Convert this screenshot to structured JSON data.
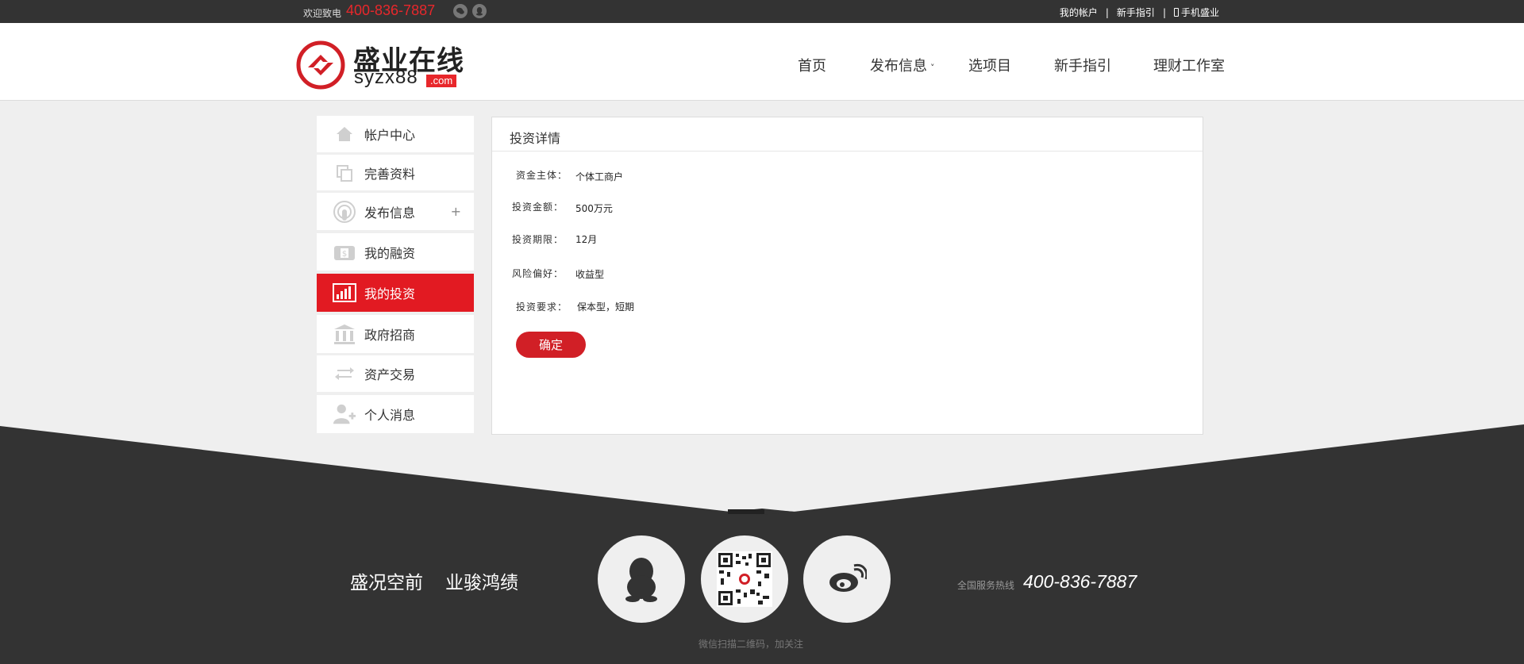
{
  "topbar": {
    "welcome": "欢迎致电",
    "phone": "400-836-7887",
    "social_icons": [
      "wechat-icon",
      "qq-icon"
    ],
    "links": [
      "我的帐户",
      "新手指引",
      "手机盛业"
    ],
    "separator": "|"
  },
  "header": {
    "logo_cn": "盛业在线",
    "logo_en": "syzx88",
    "logo_domain": ".com",
    "nav": [
      {
        "label": "首页"
      },
      {
        "label": "发布信息",
        "caret": "˅"
      },
      {
        "label": "选项目"
      },
      {
        "label": "新手指引"
      },
      {
        "label": "理财工作室"
      }
    ]
  },
  "sidebar": {
    "items": [
      {
        "label": "帐户中心",
        "icon": "home-icon"
      },
      {
        "label": "完善资料",
        "icon": "copy-icon"
      },
      {
        "label": "发布信息",
        "icon": "broadcast-icon",
        "expander": "+"
      },
      {
        "label": "我的融资",
        "icon": "wallet-icon"
      },
      {
        "label": "我的投资",
        "icon": "bar-chart-icon",
        "active": true
      },
      {
        "label": "政府招商",
        "icon": "government-building-icon"
      },
      {
        "label": "资产交易",
        "icon": "exchange-arrows-icon"
      },
      {
        "label": "个人消息",
        "icon": "user-add-icon"
      }
    ],
    "active_color": "#e21a22"
  },
  "panel": {
    "title": "投资详情",
    "fields": [
      {
        "label": "资金主体：",
        "value": "个体工商户"
      },
      {
        "label": "投资金额：",
        "value": "500万元"
      },
      {
        "label": "投资期限：",
        "value": "12月"
      },
      {
        "label": "风险偏好：",
        "value": "收益型"
      },
      {
        "label": "投资要求：",
        "value": "保本型，短期"
      }
    ],
    "confirm_label": "确定"
  },
  "footer": {
    "slogan_1": "盛况空前",
    "slogan_2": "业骏鸿绩",
    "circle_icons": [
      "qq-penguin-icon",
      "qr-code-icon",
      "weibo-icon"
    ],
    "qr_note": "微信扫描二维码，加关注",
    "hotline_label": "全国服务热线",
    "hotline": "400-836-7887",
    "background_color": "#333333"
  }
}
